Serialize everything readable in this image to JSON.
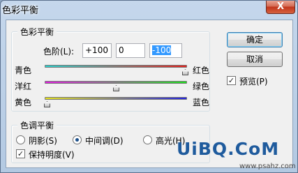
{
  "window": {
    "title": "色彩平衡",
    "close_glyph": "X"
  },
  "color_balance": {
    "legend": "色彩平衡",
    "levels_label": "色阶(L):",
    "levels": [
      "+100",
      "0",
      "-100"
    ],
    "sliders": [
      {
        "left": "青色",
        "right": "红色",
        "value": 100
      },
      {
        "left": "洋红",
        "right": "绿色",
        "value": 0
      },
      {
        "left": "黄色",
        "right": "蓝色",
        "value": -100
      }
    ]
  },
  "tone_balance": {
    "legend": "色调平衡",
    "options": [
      {
        "label": "阴影(S)",
        "selected": false
      },
      {
        "label": "中间调(D)",
        "selected": true
      },
      {
        "label": "高光(H)",
        "selected": false
      }
    ],
    "preserve_label": "保持明度(V)",
    "preserve_checked": true
  },
  "buttons": {
    "ok": "确定",
    "cancel": "取消"
  },
  "preview": {
    "label": "预览(P)",
    "checked": true
  },
  "watermark": {
    "logo": "UiBQ.CoM",
    "url": "www.psahz.com"
  },
  "colors": {
    "track_cyan_red": [
      "#29d3cf",
      "#e8211c"
    ],
    "track_magenta_green": [
      "#e21fe2",
      "#1fe01f"
    ],
    "track_yellow_blue": [
      "#e5e21c",
      "#2424e0"
    ],
    "selection": "#3399ff"
  }
}
